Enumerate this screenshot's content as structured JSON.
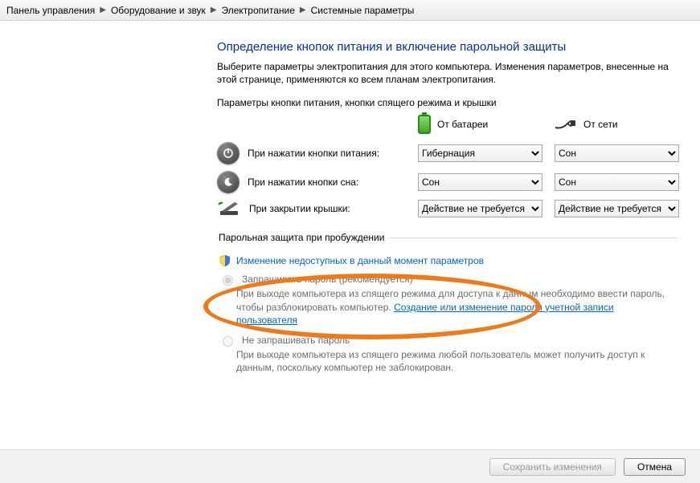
{
  "breadcrumb": [
    "Панель управления",
    "Оборудование и звук",
    "Электропитание",
    "Системные параметры"
  ],
  "page": {
    "title": "Определение кнопок питания и включение парольной защиты",
    "intro": "Выберите параметры электропитания для этого компьютера. Изменения параметров, внесенные на этой странице, применяются ко всем планам электропитания.",
    "group1_title": "Параметры кнопки питания, кнопки спящего режима и крышки",
    "col_battery": "От батареи",
    "col_ac": "От сети"
  },
  "rows": {
    "power": {
      "label": "При нажатии кнопки питания:",
      "battery": "Гибернация",
      "ac": "Сон"
    },
    "sleep": {
      "label": "При нажатии кнопки сна:",
      "battery": "Сон",
      "ac": "Сон"
    },
    "lid": {
      "label": "При закрытии крышки:",
      "battery": "Действие не требуется",
      "ac": "Действие не требуется"
    }
  },
  "password_section": {
    "legend": "Парольная защита при пробуждении",
    "change_link": "Изменение недоступных в данный момент параметров",
    "opt_require_label": "Запрашивать пароль (рекомендуется)",
    "opt_require_desc_pre": "При выходе компьютера из спящего режима для доступа к данным необходимо ввести пароль, чтобы разблокировать компьютер. ",
    "opt_require_link": "Создание или изменение пароля учетной записи пользователя",
    "opt_norequire_label": "Не запрашивать пароль",
    "opt_norequire_desc": "При выходе компьютера из спящего режима любой пользователь может получить доступ к данным, поскольку компьютер не заблокирован."
  },
  "footer": {
    "save": "Сохранить изменения",
    "cancel": "Отмена"
  }
}
